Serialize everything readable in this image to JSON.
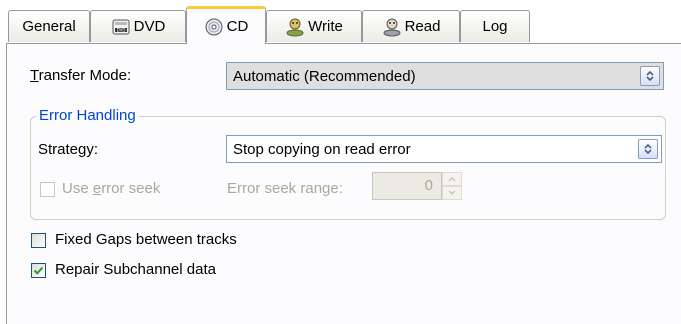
{
  "tabs": [
    {
      "label": "General",
      "icon": "none",
      "active": false
    },
    {
      "label": "DVD",
      "icon": "dvd-drive-icon",
      "active": false
    },
    {
      "label": "CD",
      "icon": "cd-disc-icon",
      "active": true
    },
    {
      "label": "Write",
      "icon": "write-person-icon",
      "active": false
    },
    {
      "label": "Read",
      "icon": "read-person-icon",
      "active": false
    },
    {
      "label": "Log",
      "icon": "none",
      "active": false
    }
  ],
  "transfer_mode": {
    "label_first": "T",
    "label_rest": "ransfer Mode:",
    "value": "Automatic (Recommended)"
  },
  "error_handling": {
    "title": "Error Handling",
    "strategy_label_pre": "Strate",
    "strategy_label_u": "g",
    "strategy_label_post": "y:",
    "strategy_value": "Stop copying on read error",
    "use_error_seek_pre": "Use ",
    "use_error_seek_u": "e",
    "use_error_seek_post": "rror seek",
    "use_error_seek_checked": false,
    "use_error_seek_enabled": false,
    "error_seek_range_label": "Error seek range:",
    "error_seek_range_value": "0"
  },
  "options": {
    "fixed_gaps_label": "Fixed Gaps between tracks",
    "fixed_gaps_checked": false,
    "repair_subchannel_label": "Repair Subchannel data",
    "repair_subchannel_checked": true
  },
  "colors": {
    "accent_title": "#0046d5",
    "active_tab_highlight": "#ffc83c",
    "disabled_text": "#aca899"
  }
}
